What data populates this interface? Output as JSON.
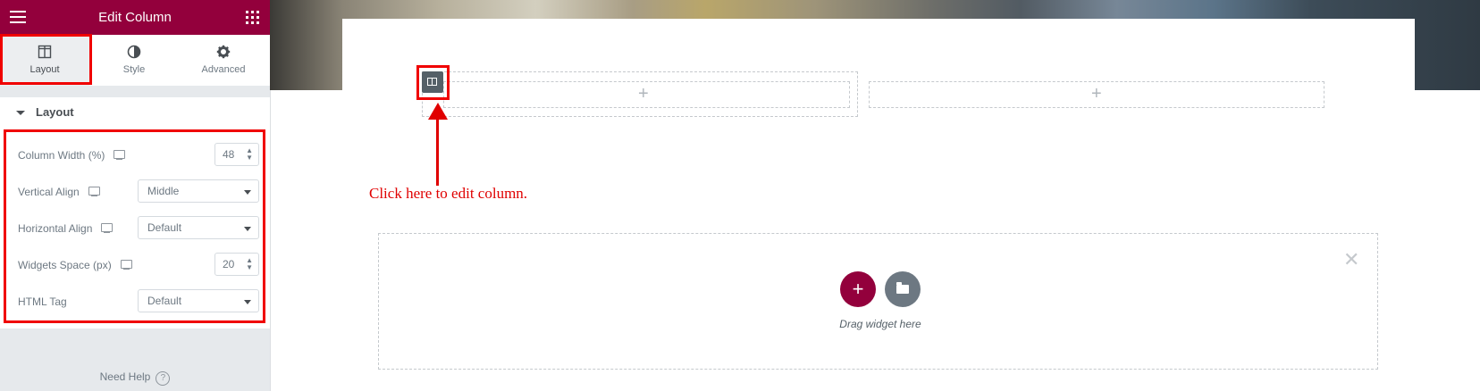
{
  "app": {
    "title": "Edit Column",
    "menu_icon": "hamburger-icon",
    "apps_icon": "grid-icon"
  },
  "tabs": [
    {
      "label": "Layout",
      "icon": "columns-icon",
      "active": true
    },
    {
      "label": "Style",
      "icon": "half-circle-icon",
      "active": false
    },
    {
      "label": "Advanced",
      "icon": "gear-icon",
      "active": false
    }
  ],
  "section": {
    "title": "Layout"
  },
  "fields": {
    "column_width": {
      "label": "Column Width (%)",
      "value": "48"
    },
    "vertical_align": {
      "label": "Vertical Align",
      "value": "Middle"
    },
    "horizontal_align": {
      "label": "Horizontal Align",
      "value": "Default"
    },
    "widgets_space": {
      "label": "Widgets Space (px)",
      "value": "20"
    },
    "html_tag": {
      "label": "HTML Tag",
      "value": "Default"
    }
  },
  "help": {
    "label": "Need Help",
    "icon": "question-icon"
  },
  "canvas": {
    "annotation": "Click here to edit column.",
    "drop_text": "Drag widget here",
    "add_symbol": "+",
    "close_symbol": "✕"
  },
  "colors": {
    "brand": "#93003c",
    "highlight": "#f00000",
    "annotation": "#e00000"
  }
}
